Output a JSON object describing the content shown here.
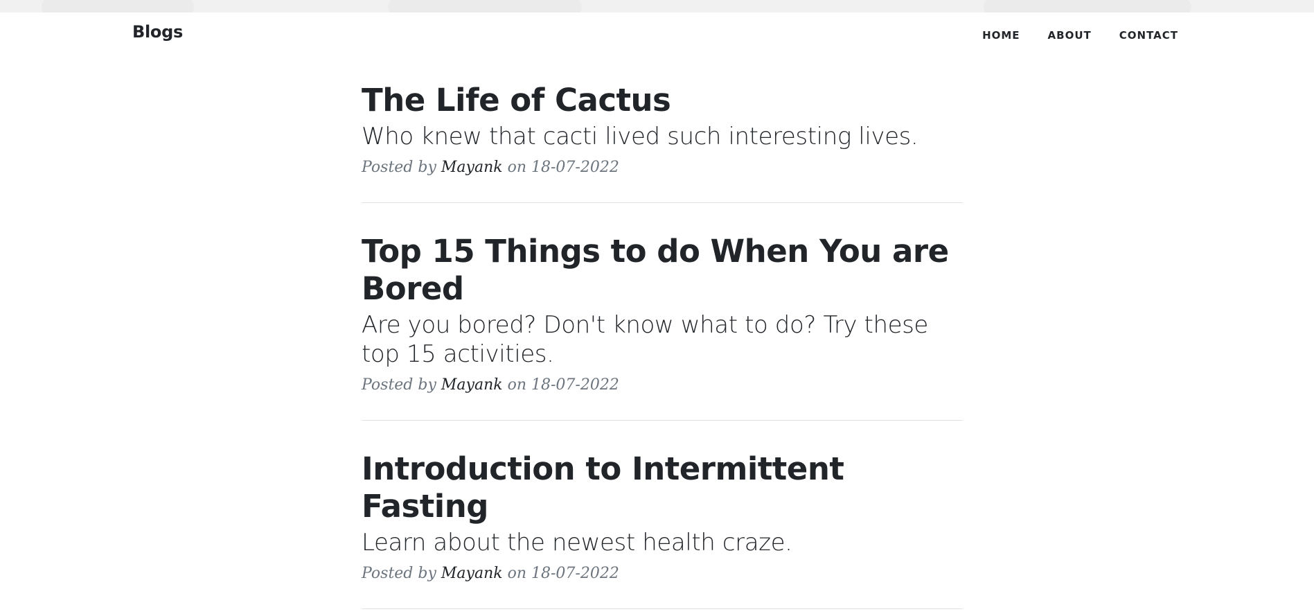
{
  "brand": "Blogs",
  "nav": {
    "home": "HOME",
    "about": "ABOUT",
    "contact": "CONTACT"
  },
  "posts": [
    {
      "title": "The Life of Cactus",
      "subtitle": "Who knew that cacti lived such interesting lives.",
      "meta_prefix": "Posted by",
      "author": "Mayank",
      "meta_on": "on 18-07-2022"
    },
    {
      "title": "Top 15 Things to do When You are Bored",
      "subtitle": "Are you bored? Don't know what to do? Try these top 15 activities.",
      "meta_prefix": "Posted by",
      "author": "Mayank",
      "meta_on": "on 18-07-2022"
    },
    {
      "title": "Introduction to Intermittent Fasting",
      "subtitle": "Learn about the newest health craze.",
      "meta_prefix": "Posted by",
      "author": "Mayank",
      "meta_on": "on 18-07-2022"
    }
  ]
}
